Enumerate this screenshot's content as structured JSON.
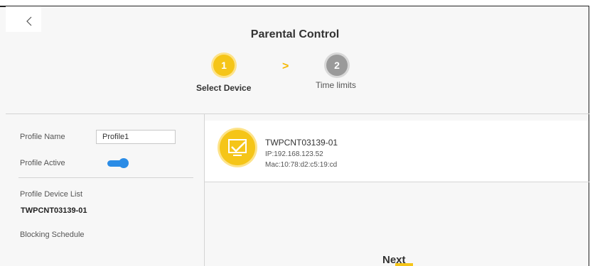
{
  "page": {
    "title": "Parental Control"
  },
  "steps": [
    {
      "number": "1",
      "label": "Select Device",
      "active": true
    },
    {
      "number": "2",
      "label": "Time limits",
      "active": false
    }
  ],
  "step_separator": ">",
  "profile": {
    "name_label": "Profile Name",
    "name_value": "Profile1",
    "active_label": "Profile Active",
    "active": true,
    "device_list_label": "Profile Device List",
    "device_list_value": "TWPCNT03139-01",
    "blocking_schedule_label": "Blocking Schedule"
  },
  "device": {
    "name": "TWPCNT03139-01",
    "ip": "IP:192.168.123.52",
    "mac": "Mac:10:78:d2:c5:19:cd",
    "icon": "monitor-check-icon"
  },
  "actions": {
    "next_label": "Next"
  },
  "colors": {
    "accent": "#f5c518",
    "toggle_on": "#2b8ce6",
    "inactive_step": "#9a9a9a"
  }
}
